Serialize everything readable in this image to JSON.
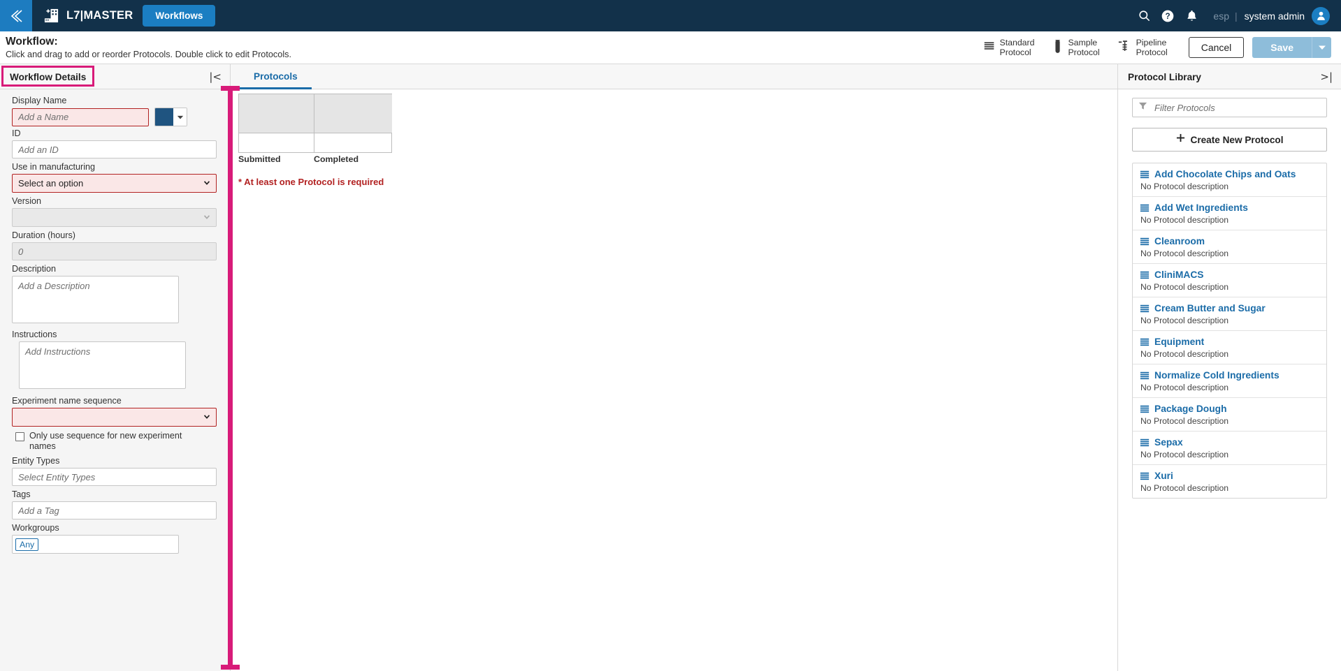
{
  "topnav": {
    "back_icon": "chevron-double-left-icon",
    "brand_logo_icon": "add-building-icon",
    "brand": "L7|MASTER",
    "active_tab": "Workflows",
    "search_icon": "search-icon",
    "help_icon": "help-circle-icon",
    "notifications_icon": "bell-icon",
    "language": "esp",
    "divider": "|",
    "user": "system admin",
    "avatar_icon": "user-avatar-icon"
  },
  "pageheader": {
    "title": "Workflow:",
    "subtitle": "Click and drag to add or reorder Protocols. Double click to edit Protocols.",
    "actions": [
      {
        "label_line1": "Standard",
        "label_line2": "Protocol",
        "icon": "stacked-bars-icon"
      },
      {
        "label_line1": "Sample",
        "label_line2": "Protocol",
        "icon": "test-tube-icon"
      },
      {
        "label_line1": "Pipeline",
        "label_line2": "Protocol",
        "icon": "pipeline-icon"
      }
    ],
    "cancel_label": "Cancel",
    "save_label": "Save",
    "save_caret_icon": "caret-down-icon"
  },
  "panels": {
    "details_title": "Workflow Details",
    "details_collapse_icon": "collapse-left-icon",
    "details_collapse_glyph": "|<",
    "protocols_tab": "Protocols",
    "library_title": "Protocol Library",
    "library_collapse_icon": "collapse-right-icon",
    "library_collapse_glyph": ">|",
    "highlight_color": "#d81b79"
  },
  "form": {
    "display_name": {
      "label": "Display Name",
      "value": "",
      "placeholder": "Add a Name",
      "state": "error"
    },
    "color_swatch": {
      "name": "color-picker",
      "color": "#1f5480",
      "caret_icon": "caret-down-icon"
    },
    "id": {
      "label": "ID",
      "value": "",
      "placeholder": "Add an ID"
    },
    "use_in_manufacturing": {
      "label": "Use in manufacturing",
      "value": "Select an option",
      "state": "error",
      "caret_icon": "chevron-down-icon"
    },
    "version": {
      "label": "Version",
      "value": "",
      "state": "disabled",
      "caret_icon": "chevron-down-icon"
    },
    "duration": {
      "label": "Duration (hours)",
      "value": "",
      "placeholder": "0",
      "state": "disabled"
    },
    "description": {
      "label": "Description",
      "value": "",
      "placeholder": "Add a Description"
    },
    "instructions": {
      "label": "Instructions",
      "value": "",
      "placeholder": "Add Instructions"
    },
    "experiment_name_sequence": {
      "label": "Experiment name sequence",
      "value": "",
      "state": "error",
      "caret_icon": "chevron-down-icon"
    },
    "only_use_sequence": {
      "label": "Only use sequence for new experiment names",
      "checked": false
    },
    "entity_types": {
      "label": "Entity Types",
      "value": "",
      "placeholder": "Select Entity Types"
    },
    "tags": {
      "label": "Tags",
      "value": "",
      "placeholder": "Add a Tag"
    },
    "workgroups": {
      "label": "Workgroups",
      "chip": "Any"
    }
  },
  "center": {
    "col_labels": [
      "Submitted",
      "Completed"
    ],
    "required_message": "* At least one Protocol is required"
  },
  "library": {
    "filter_placeholder": "Filter Protocols",
    "filter_value": "",
    "filter_icon": "funnel-icon",
    "create_label": "Create New Protocol",
    "create_icon": "plus-icon",
    "no_description_text": "No Protocol description",
    "items": [
      {
        "name": "Add Chocolate Chips and Oats",
        "desc": "No Protocol description",
        "icon": "stacked-bars-icon"
      },
      {
        "name": "Add Wet Ingredients",
        "desc": "No Protocol description",
        "icon": "stacked-bars-icon"
      },
      {
        "name": "Cleanroom",
        "desc": "No Protocol description",
        "icon": "stacked-bars-icon"
      },
      {
        "name": "CliniMACS",
        "desc": "No Protocol description",
        "icon": "stacked-bars-icon"
      },
      {
        "name": "Cream Butter and Sugar",
        "desc": "No Protocol description",
        "icon": "stacked-bars-icon"
      },
      {
        "name": "Equipment",
        "desc": "No Protocol description",
        "icon": "stacked-bars-icon"
      },
      {
        "name": "Normalize Cold Ingredients",
        "desc": "No Protocol description",
        "icon": "stacked-bars-icon"
      },
      {
        "name": "Package Dough",
        "desc": "No Protocol description",
        "icon": "stacked-bars-icon"
      },
      {
        "name": "Sepax",
        "desc": "No Protocol description",
        "icon": "stacked-bars-icon"
      },
      {
        "name": "Xuri",
        "desc": "No Protocol description",
        "icon": "stacked-bars-icon"
      }
    ]
  },
  "colors": {
    "nav_bg": "#12314a",
    "accent_blue": "#1b7ec2",
    "link_blue": "#1b6ca8",
    "error_red": "#b22222",
    "highlight_pink": "#d81b79"
  }
}
